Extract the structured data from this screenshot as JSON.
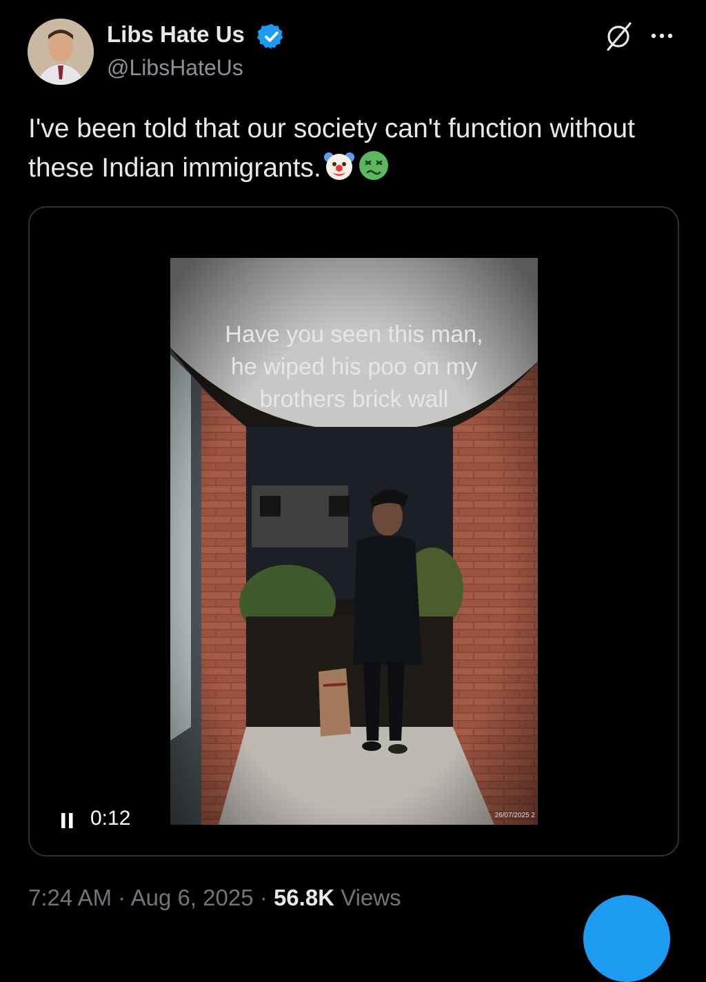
{
  "author": {
    "display_name": "Libs Hate Us",
    "handle": "@LibsHateUs",
    "verified": true
  },
  "tweet": {
    "text": "I've been told that our society can't function without these Indian immigrants.",
    "emojis": [
      "clown-face",
      "nauseated-face"
    ]
  },
  "video": {
    "overlay_lines": [
      "Have you seen this man,",
      "he wiped his poo on my",
      "brothers brick wall"
    ],
    "date_stamp": "26/07/2025 2",
    "elapsed": "0:12",
    "state_icon": "pause-icon"
  },
  "meta": {
    "time": "7:24 AM",
    "separator": "·",
    "date": "Aug 6, 2025",
    "views_count": "56.8K",
    "views_label": "Views"
  },
  "colors": {
    "background": "#000000",
    "text_primary": "#e7e9ea",
    "text_secondary": "#71767b",
    "accent": "#1d9bf0",
    "border": "#2f3336"
  },
  "icons": [
    "grok-icon",
    "more-icon",
    "verified-badge-icon",
    "pause-icon"
  ]
}
